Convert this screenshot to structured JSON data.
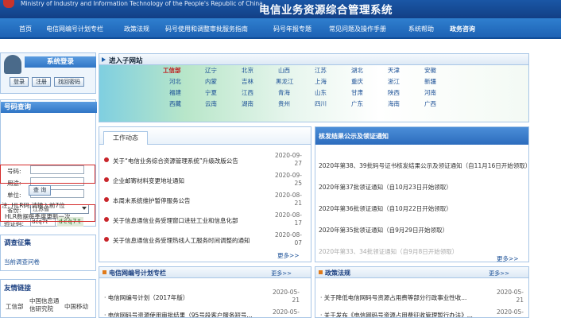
{
  "header": {
    "ministry": "Ministry of Industry and Information Technology of the People's Republic of China",
    "system": "电信业务资源综合管理系统"
  },
  "nav": [
    "首页",
    "电信网编号计划专栏",
    "政策法规",
    "码号使用和调整审批服务指南",
    "码号年报专题",
    "常见问题及操作手册",
    "系统帮助",
    "政务咨询"
  ],
  "login": {
    "title": "系统登录",
    "buttons": [
      "登录",
      "注册",
      "找回密码"
    ]
  },
  "query": {
    "title": "号码查询",
    "labels": [
      "号码:",
      "用途:",
      "单位:",
      "省份:",
      "验证码:"
    ],
    "province": "江苏省",
    "captcha_input": "dcq7t",
    "captcha_image": "dcq7t",
    "button": "查 询",
    "note1": "注: HLR码,请输入前7位",
    "note2": "HLR数据每季度更新一次"
  },
  "survey": {
    "title": "调查征集",
    "item": "当前调查问卷"
  },
  "friends": {
    "title": "友情链接",
    "links": [
      "工信部",
      "中国信息通信研究院",
      "中国移动"
    ]
  },
  "subsites": {
    "title": "进入子网站",
    "hq": "工信部",
    "provinces": [
      [
        "辽宁",
        "北京",
        "山西",
        "江苏",
        "湖北",
        "天津",
        "安徽"
      ],
      [
        "河北",
        "内蒙",
        "吉林",
        "黑龙江",
        "上海",
        "重庆",
        "浙江",
        "新疆"
      ],
      [
        "福建",
        "宁夏",
        "江西",
        "青海",
        "山东",
        "甘肃",
        "陕西",
        "河南"
      ],
      [
        "西藏",
        "云南",
        "湖南",
        "贵州",
        "四川",
        "广东",
        "海南",
        "广西"
      ]
    ]
  },
  "work": {
    "tab": "工作动态",
    "items": [
      {
        "title": "关于“电信业务综合资源管理系统”升级改版公告",
        "date1": "2020-09-",
        "date2": "27"
      },
      {
        "title": "企业邮寄材料变更地址通知",
        "date1": "2020-09-",
        "date2": "25"
      },
      {
        "title": "本周末系统维护暂停服务公告",
        "date1": "2020-08-",
        "date2": "21"
      },
      {
        "title": "关于信息通信业务受理窗口进驻工业和信息化部",
        "date1": "2020-08-",
        "date2": "17"
      },
      {
        "title": "关于信息通信业务受理热线人工服务时间调整的通知",
        "date1": "2020-08-",
        "date2": "07"
      }
    ],
    "more": "更多>>"
  },
  "quota": {
    "title": "核发结果公示及领证通知",
    "items": [
      "2020年第38、39批码号证书核发结果公示及领证通知（自11月16日开始领取）",
      "2020年第37批领证通知（自10月23日开始领取）",
      "2020年第36批领证通知（自10月22日开始领取）",
      "2020年第35批领证通知（自9月29日开始领取）",
      "2020年第33、34批领证通知（自9月8日开始领取）"
    ],
    "more": "更多>>"
  },
  "plan": {
    "title": "电信网编号计划专栏",
    "more": "更多>>",
    "items": [
      {
        "title": "电信网编号计划（2017年版）",
        "date1": "2020-05-",
        "date2": "21"
      },
      {
        "title": "电信网码号资源使用审批结果（95号段客户服务短号...",
        "date1": "2020-05-",
        "date2": "21"
      }
    ]
  },
  "policy": {
    "title": "政策法规",
    "more": "更多>>",
    "items": [
      {
        "title": "关于降低电信网码号资源占用费等部分行政事业性收...",
        "date1": "2020-05-",
        "date2": "21"
      },
      {
        "title": "关于发布《电信网码号资源占用费征收管理暂行办法》...",
        "date1": "2020-05-",
        "date2": "21"
      }
    ]
  }
}
